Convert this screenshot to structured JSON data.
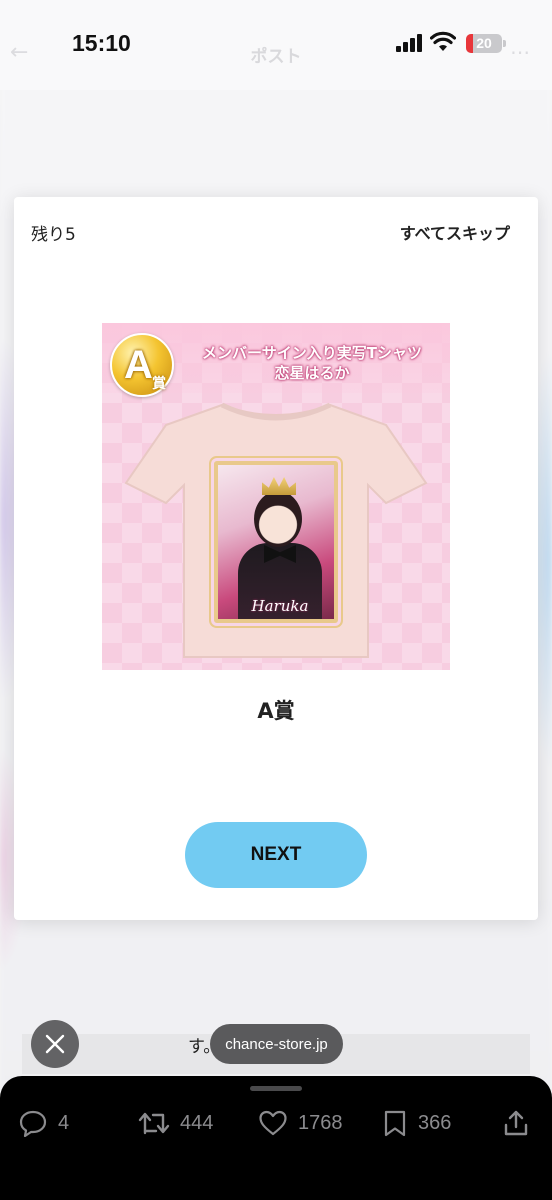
{
  "status_bar": {
    "time": "15:10",
    "battery": "20",
    "battery_level": 0.2,
    "background_title": "ポスト"
  },
  "modal": {
    "remaining": "残り5",
    "skip_all": "すべてスキップ",
    "prize_image": {
      "badge_letter": "A",
      "badge_suffix": "賞",
      "title_line1": "メンバーサイン入り実写Tシャツ",
      "title_line2": "恋星はるか",
      "signature": "Haruka"
    },
    "prize_name": "A賞",
    "next_label": "NEXT"
  },
  "background_text": "す。",
  "url_pill": "chance-store.jp",
  "actions": {
    "replies": "4",
    "reposts": "444",
    "likes": "1768",
    "bookmarks": "366"
  },
  "colors": {
    "next_button": "#72cbf2",
    "battery_low": "#e8363a",
    "prize_bg": "#f7cde0"
  },
  "icons": [
    "signal-icon",
    "wifi-icon",
    "battery-icon",
    "close-icon",
    "reply-icon",
    "repost-icon",
    "like-icon",
    "bookmark-icon",
    "share-icon"
  ]
}
